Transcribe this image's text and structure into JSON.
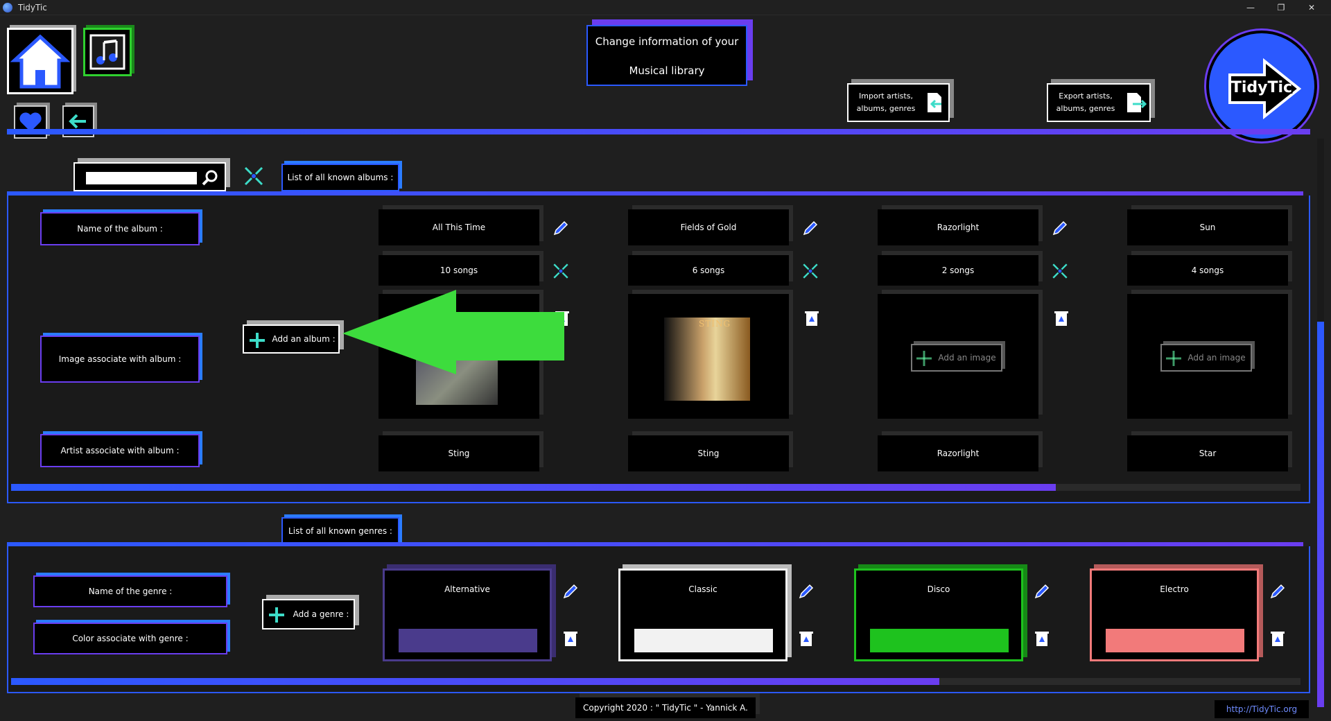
{
  "window": {
    "title": "TidyTic"
  },
  "header": {
    "banner_line1": "Change information of your",
    "banner_line2": "Musical library",
    "import_label_l1": "Import artists,",
    "import_label_l2": "albums, genres",
    "export_label_l1": "Export artists,",
    "export_label_l2": "albums, genres",
    "logo_text": "TidyTic"
  },
  "albums": {
    "section_label": "List of all known albums :",
    "search_value": "",
    "row_labels": {
      "name": "Name of the album :",
      "image": "Image associate with album :",
      "artist": "Artist associate with album :"
    },
    "add_label": "Add an album :",
    "items": [
      {
        "name": "All This Time",
        "songs": "10 songs",
        "artist": "Sting",
        "has_image": true
      },
      {
        "name": "Fields of Gold",
        "songs": "6 songs",
        "artist": "Sting",
        "has_image": true,
        "cover_text": "STING"
      },
      {
        "name": "Razorlight",
        "songs": "2 songs",
        "artist": "Razorlight",
        "has_image": false,
        "add_image_label": "Add an image"
      },
      {
        "name": "Sun",
        "songs": "4 songs",
        "artist": "Star",
        "has_image": false,
        "add_image_label": "Add an image"
      }
    ],
    "scroll_fraction": 0.81
  },
  "genres": {
    "section_label": "List of all known genres :",
    "row_labels": {
      "name": "Name of the genre :",
      "color": "Color associate with genre :"
    },
    "add_label": "Add a genre :",
    "items": [
      {
        "name": "Alternative",
        "color": "#4a3b8c"
      },
      {
        "name": "Classic",
        "color": "#f2f2f2"
      },
      {
        "name": "Disco",
        "color": "#1ec21e"
      },
      {
        "name": "Electro",
        "color": "#f27a7a"
      }
    ],
    "scroll_fraction": 0.72
  },
  "footer": {
    "copyright": "Copyright 2020 : \" TidyTic \" - Yannick A.",
    "link": "http://TidyTic.org"
  },
  "colors": {
    "accent_blue": "#2b59ff",
    "accent_purple": "#6a3df0",
    "arrow_green": "#3ddc3d"
  }
}
